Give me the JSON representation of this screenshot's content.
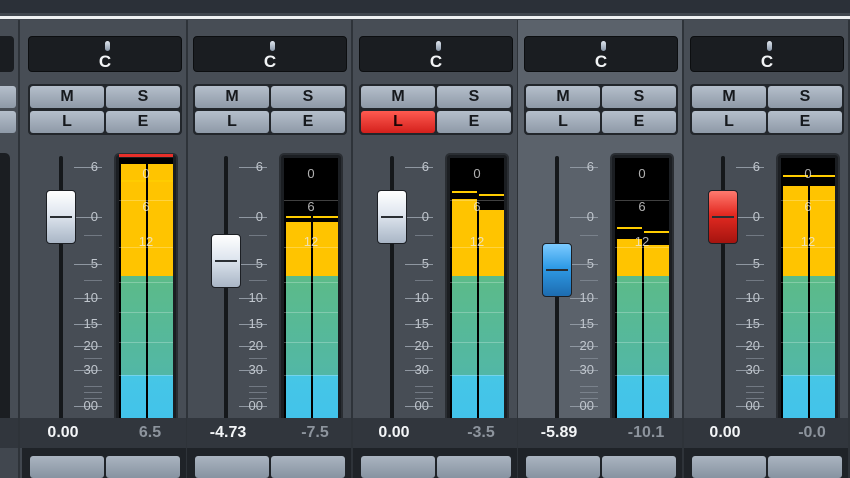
{
  "scale_labels": [
    "6",
    "0",
    "5",
    "10",
    "15",
    "20",
    "30",
    "00"
  ],
  "meter_labels": [
    "0",
    "6",
    "12"
  ],
  "buttons": {
    "mute": "M",
    "solo": "S",
    "listen": "L",
    "edit": "E"
  },
  "colors": {
    "listen_active": "#e3302a",
    "fader_selected": "#2f9be6",
    "fader_record": "#e32a22",
    "meter_green": "#5cbb88",
    "meter_yellow": "#ffc400",
    "meter_cyan": "#46c6e6"
  },
  "channels": [
    {
      "pan": "C",
      "volume": "0.00",
      "peak": "6.5",
      "fader_color": "white",
      "fader_level_db": 0,
      "listen_active": false,
      "selected": false,
      "meter_level_db": [
        4,
        4
      ],
      "peak_hold_db": [
        -1,
        -1
      ],
      "clip": true
    },
    {
      "pan": "C",
      "volume": "-4.73",
      "peak": "-7.5",
      "fader_color": "white",
      "fader_level_db": -4.73,
      "listen_active": false,
      "selected": false,
      "meter_level_db": [
        -8.5,
        -8.5
      ],
      "peak_hold_db": [
        -7.5,
        -7.5
      ],
      "clip": false
    },
    {
      "pan": "C",
      "volume": "0.00",
      "peak": "-3.5",
      "fader_color": "white",
      "fader_level_db": 0,
      "listen_active": true,
      "selected": false,
      "meter_level_db": [
        -4.5,
        -6.5
      ],
      "peak_hold_db": [
        -3,
        -3.5
      ],
      "clip": false
    },
    {
      "pan": "C",
      "volume": "-5.89",
      "peak": "-10.1",
      "fader_color": "blue",
      "fader_level_db": -5.89,
      "listen_active": false,
      "selected": true,
      "meter_level_db": [
        -11.5,
        -12.5
      ],
      "peak_hold_db": [
        -9.5,
        -10.1
      ],
      "clip": false
    },
    {
      "pan": "C",
      "volume": "0.00",
      "peak": "-0.0",
      "fader_color": "red",
      "fader_level_db": 0,
      "listen_active": false,
      "selected": false,
      "meter_level_db": [
        -2,
        -2
      ],
      "peak_hold_db": [
        0,
        0
      ],
      "clip": false
    }
  ]
}
